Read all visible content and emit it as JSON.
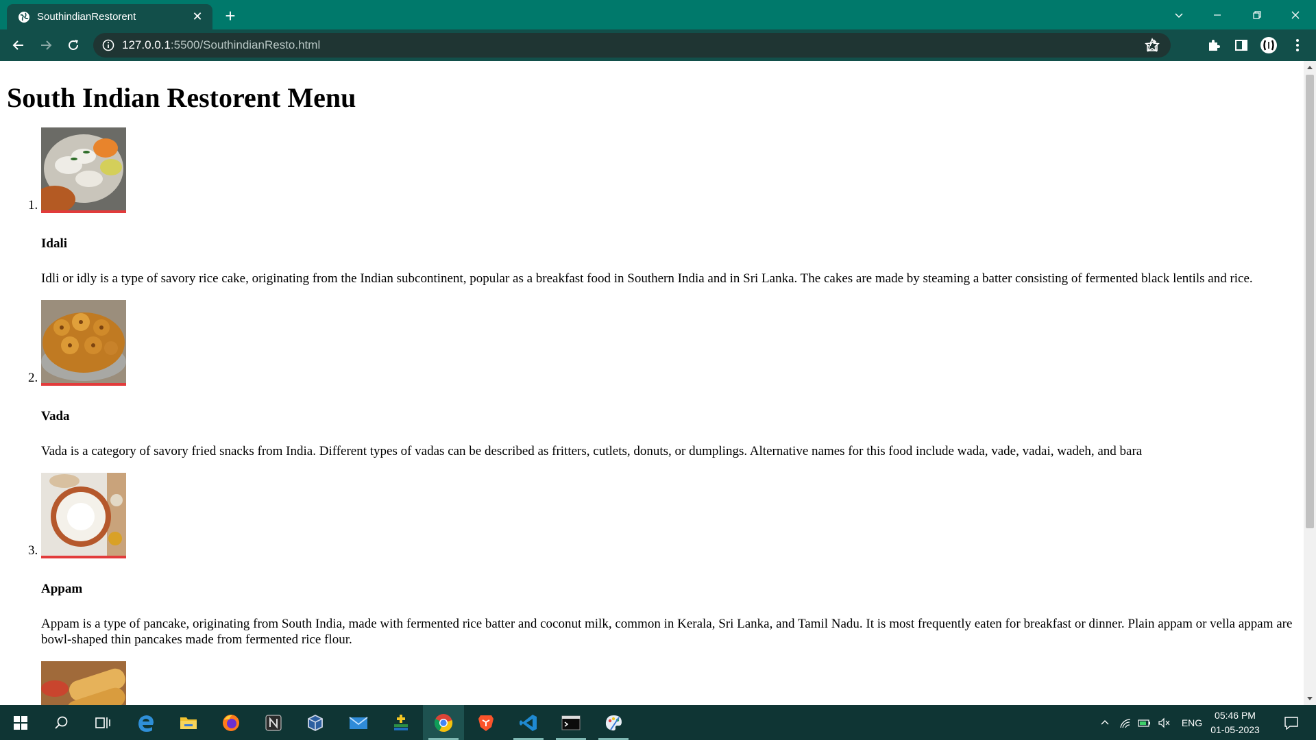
{
  "browser": {
    "tab_title": "SouthindianRestorent",
    "url_host": "127.0.0.1",
    "url_path": ":5500/SouthindianResto.html"
  },
  "page": {
    "heading": "South Indian Restorent Menu",
    "items": [
      {
        "number": "1.",
        "name": "Idali",
        "description": "Idli or idly is a type of savory rice cake, originating from the Indian subcontinent, popular as a breakfast food in Southern India and in Sri Lanka. The cakes are made by steaming a batter consisting of fermented black lentils and rice."
      },
      {
        "number": "2.",
        "name": "Vada",
        "description": "Vada is a category of savory fried snacks from India. Different types of vadas can be described as fritters, cutlets, donuts, or dumplings. Alternative names for this food include wada, vade, vadai, wadeh, and bara"
      },
      {
        "number": "3.",
        "name": "Appam",
        "description": "Appam is a type of pancake, originating from South India, made with fermented rice batter and coconut milk, common in Kerala, Sri Lanka, and Tamil Nadu. It is most frequently eaten for breakfast or dinner. Plain appam or vella appam are bowl-shaped thin pancakes made from fermented rice flour."
      }
    ]
  },
  "taskbar": {
    "language": "ENG",
    "time": "05:46 PM",
    "date": "01-05-2023"
  },
  "colors": {
    "titlebar": "#00796b",
    "toolbar": "#124f4a",
    "taskbar": "#0f3534",
    "image_underline": "#e23b3b"
  }
}
